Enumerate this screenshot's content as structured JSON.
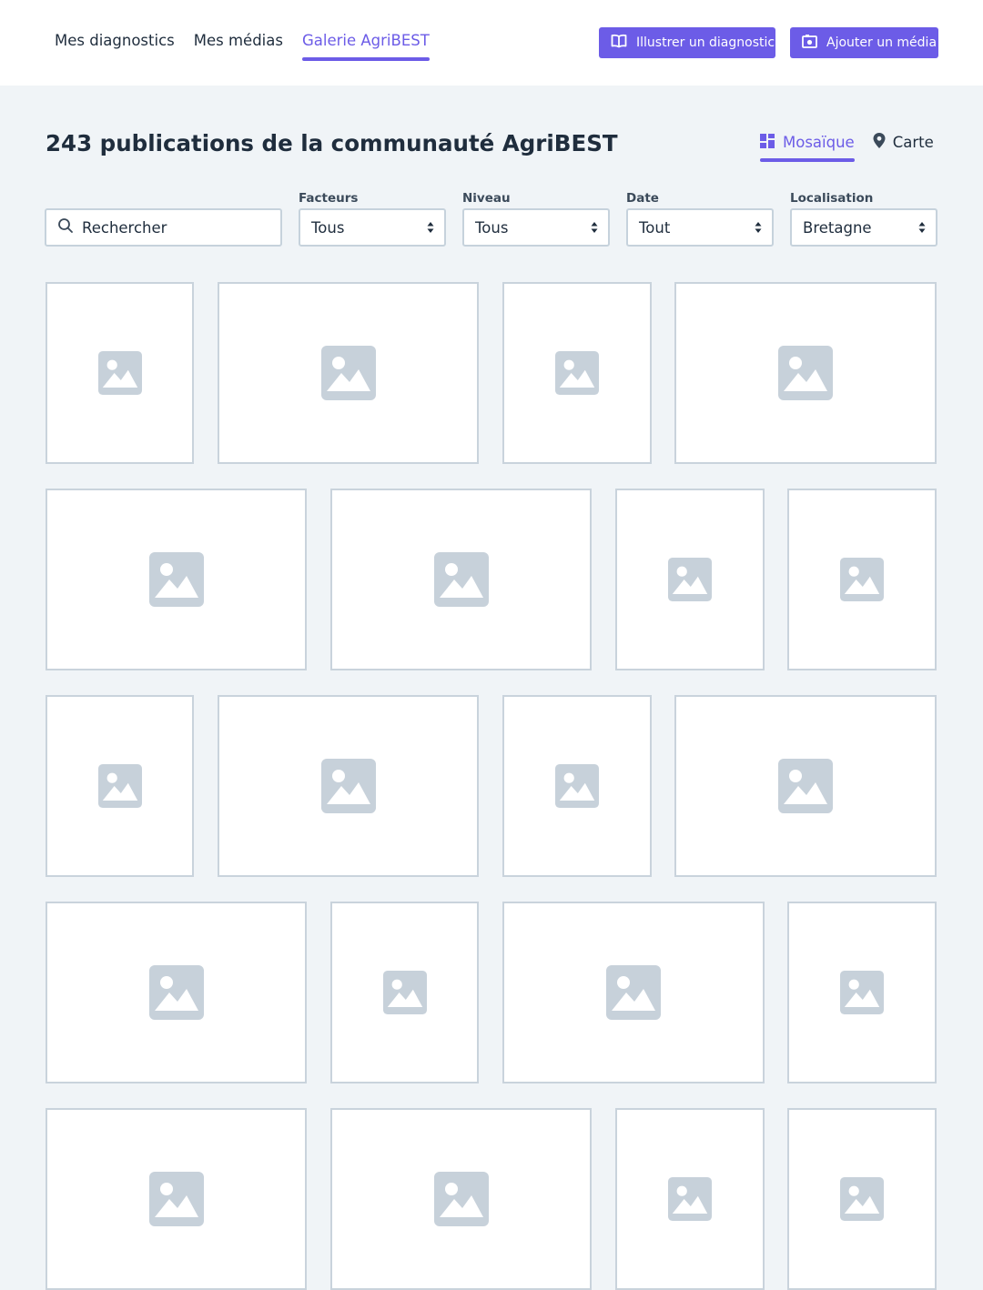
{
  "nav": {
    "items": [
      {
        "label": "Mes diagnostics",
        "active": false
      },
      {
        "label": "Mes médias",
        "active": false
      },
      {
        "label": "Galerie AgriBEST",
        "active": true
      }
    ]
  },
  "actions": {
    "illustrer_label": "Illustrer un diagnostic",
    "ajouter_label": "Ajouter un média"
  },
  "page": {
    "title": "243 publications de la communauté AgriBEST"
  },
  "view_toggle": {
    "mosaique": "Mosaïque",
    "carte": "Carte"
  },
  "filters": {
    "search_placeholder": "Rechercher",
    "facteurs": {
      "label": "Facteurs",
      "value": "Tous"
    },
    "niveau": {
      "label": "Niveau",
      "value": "Tous"
    },
    "date": {
      "label": "Date",
      "value": "Tout"
    },
    "localisation": {
      "label": "Localisation",
      "value": "Bretagne"
    }
  },
  "colors": {
    "accent": "#6c5ce7",
    "background": "#f0f4f7",
    "placeholder_icon": "#c7d1da",
    "tile_border": "#c9d3dc"
  },
  "gallery": {
    "item_icon": "image-placeholder-icon"
  }
}
